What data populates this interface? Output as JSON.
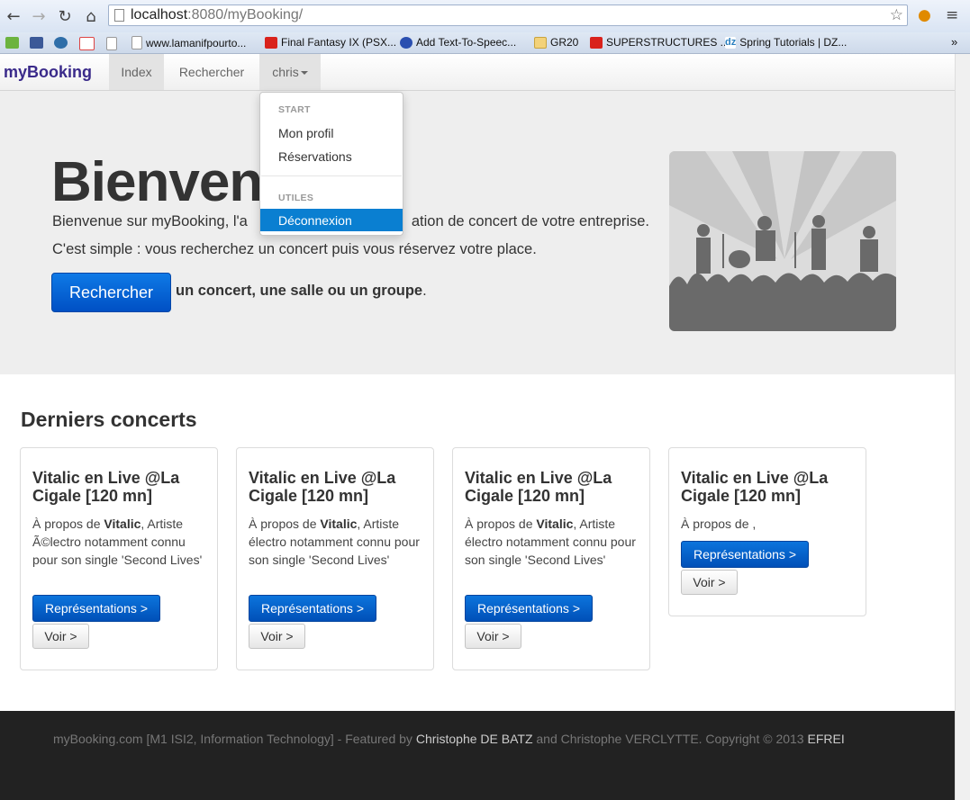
{
  "browser": {
    "url_host": "localhost",
    "url_rest": ":8080/myBooking/",
    "bookmarks": [
      "www.lamanifpourto...",
      "Final Fantasy IX (PSX...",
      "Add Text-To-Speec...",
      "GR20",
      "SUPERSTRUCTURES ...",
      "Spring Tutorials | DZ..."
    ],
    "more": "»"
  },
  "navbar": {
    "brand": "myBooking",
    "items": [
      "Index",
      "Rechercher"
    ],
    "user": "chris"
  },
  "dropdown": {
    "header_start": "START",
    "item_profile": "Mon profil",
    "item_reservations": "Réservations",
    "header_utiles": "UTILES",
    "item_logout": "Déconnexion"
  },
  "hero": {
    "title": "Bienven",
    "line1_start": "Bienvenue sur myBooking, l'a",
    "line1_end": "ation de concert de votre entreprise.",
    "line2": "C'est simple : vous recherchez un concert puis vous réservez votre place.",
    "button": "Rechercher",
    "after_bold": "un concert, une salle ou un groupe",
    "after_end": "."
  },
  "section": {
    "title": "Derniers concerts"
  },
  "cards": [
    {
      "title": "Vitalic en Live @La Cigale [120 mn]",
      "about": "À propos de ",
      "artist": "Vitalic",
      "desc": ", Artiste Ã©lectro notamment connu pour son single 'Second Lives'",
      "rep": "Représentations >",
      "voir": "Voir >"
    },
    {
      "title": "Vitalic en Live @La Cigale [120 mn]",
      "about": "À propos de ",
      "artist": "Vitalic",
      "desc": ", Artiste électro notamment connu pour son single 'Second Lives'",
      "rep": "Représentations >",
      "voir": "Voir >"
    },
    {
      "title": "Vitalic en Live @La Cigale [120 mn]",
      "about": "À propos de ",
      "artist": "Vitalic",
      "desc": ", Artiste électro notamment connu pour son single 'Second Lives'",
      "rep": "Représentations >",
      "voir": "Voir >"
    },
    {
      "title": "Vitalic en Live @La Cigale [120 mn]",
      "about": "À propos de ",
      "artist": "",
      "desc": ",",
      "rep": "Représentations >",
      "voir": "Voir >"
    }
  ],
  "footer": {
    "part1": "myBooking.com [M1 ISI2, Information Technology] - Featured by ",
    "author1": "Christophe DE BATZ",
    "part2": " and Christophe VERCLYTTE. Copyright © 2013 ",
    "org": "EFREI"
  },
  "colors": {
    "primary_button": "#0a66d6",
    "dropdown_active": "#0a7fd1",
    "brand": "#3a2a8a",
    "footer_bg": "#222222"
  }
}
